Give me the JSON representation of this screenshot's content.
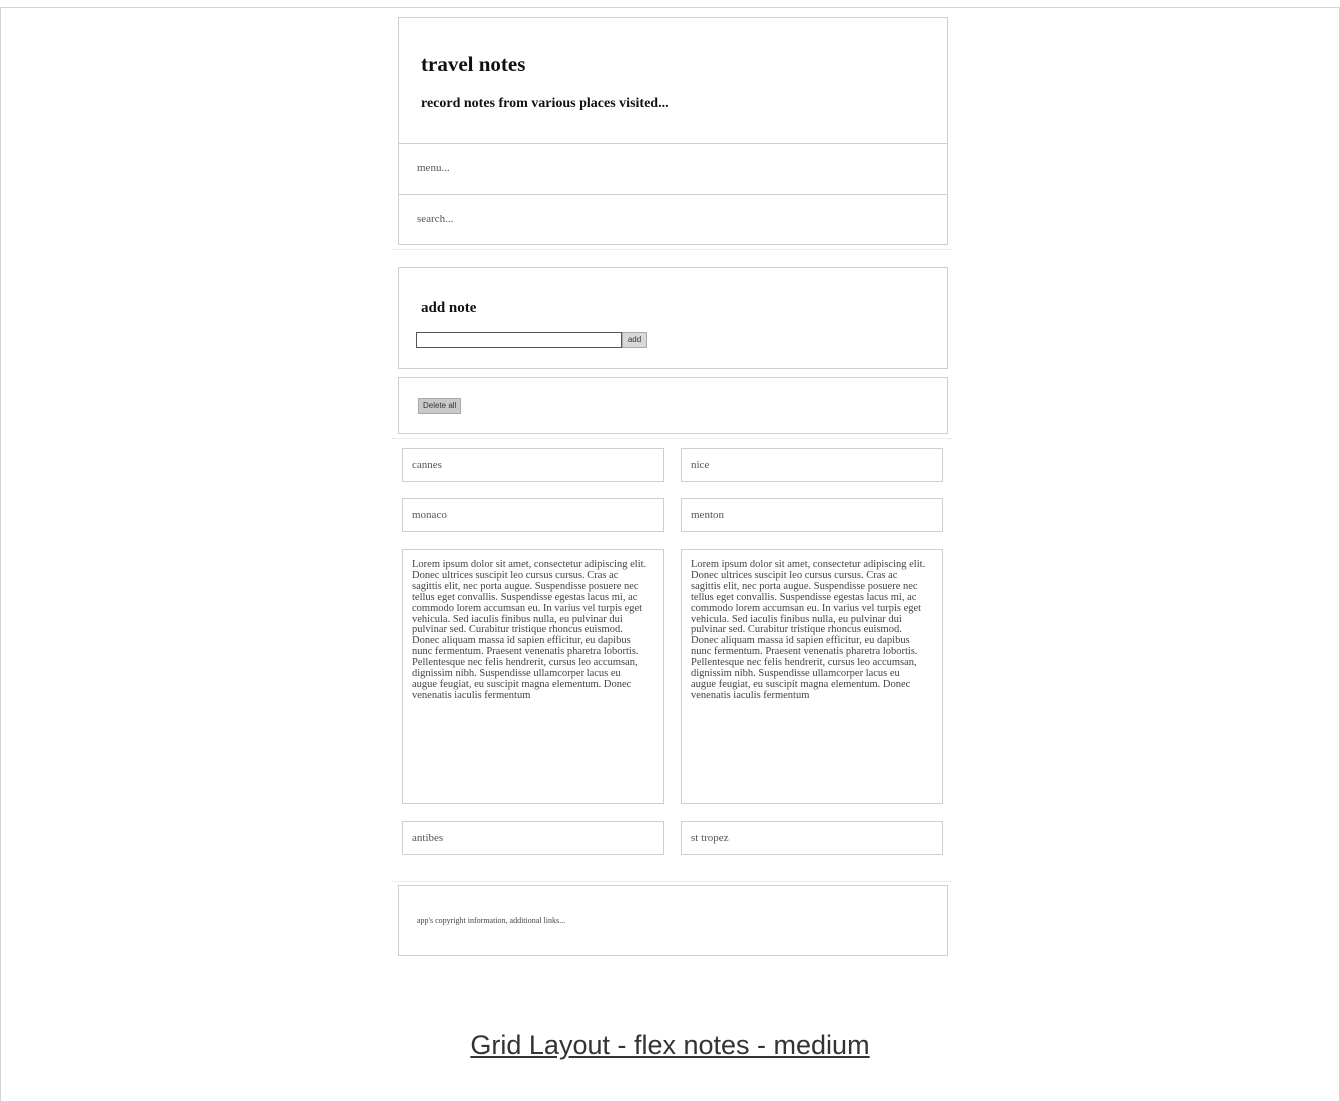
{
  "header": {
    "title": "travel notes",
    "subtitle": "record notes from various places visited..."
  },
  "nav": {
    "menu_text": "menu...",
    "search_text": "search..."
  },
  "add_note": {
    "title": "add note",
    "input_value": "",
    "add_label": "add"
  },
  "actions": {
    "delete_all_label": "Delete all"
  },
  "notes": [
    {
      "text": "cannes"
    },
    {
      "text": "nice"
    },
    {
      "text": "monaco"
    },
    {
      "text": "menton"
    },
    {
      "text": "Lorem ipsum dolor sit amet, consectetur adipiscing elit. Donec ultrices suscipit leo cursus cursus. Cras ac sagittis elit, nec porta augue. Suspendisse posuere nec tellus eget convallis. Suspendisse egestas lacus mi, ac commodo lorem accumsan eu. In varius vel turpis eget vehicula. Sed iaculis finibus nulla, eu pulvinar dui pulvinar sed. Curabitur tristique rhoncus euismod. Donec aliquam massa id sapien efficitur, eu dapibus nunc fermentum. Praesent venenatis pharetra lobortis. Pellentesque nec felis hendrerit, cursus leo accumsan, dignissim nibh. Suspendisse ullamcorper lacus eu augue feugiat, eu suscipit magna elementum. Donec venenatis iaculis fermentum"
    },
    {
      "text": "Lorem ipsum dolor sit amet, consectetur adipiscing elit. Donec ultrices suscipit leo cursus cursus. Cras ac sagittis elit, nec porta augue. Suspendisse posuere nec tellus eget convallis. Suspendisse egestas lacus mi, ac commodo lorem accumsan eu. In varius vel turpis eget vehicula. Sed iaculis finibus nulla, eu pulvinar dui pulvinar sed. Curabitur tristique rhoncus euismod. Donec aliquam massa id sapien efficitur, eu dapibus nunc fermentum. Praesent venenatis pharetra lobortis. Pellentesque nec felis hendrerit, cursus leo accumsan, dignissim nibh. Suspendisse ullamcorper lacus eu augue feugiat, eu suscipit magna elementum. Donec venenatis iaculis fermentum"
    },
    {
      "text": "antibes"
    },
    {
      "text": "st tropez"
    }
  ],
  "footer": {
    "text": "app's copyright information, additional links..."
  },
  "caption": {
    "text": "Grid Layout - flex notes - medium"
  }
}
